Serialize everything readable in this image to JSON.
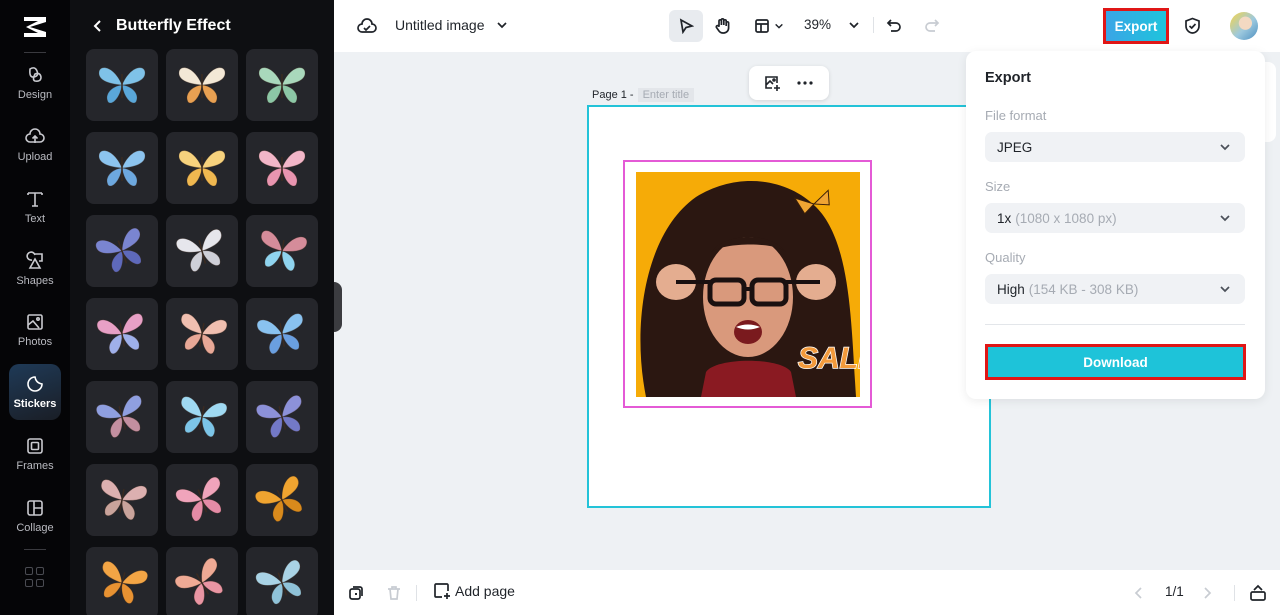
{
  "nav": {
    "logo": "capcut-logo",
    "items": [
      {
        "label": "Design",
        "icon": "design-icon",
        "active": false
      },
      {
        "label": "Upload",
        "icon": "upload-cloud-icon",
        "active": false
      },
      {
        "label": "Text",
        "icon": "text-icon",
        "active": false
      },
      {
        "label": "Shapes",
        "icon": "shapes-icon",
        "active": false
      },
      {
        "label": "Photos",
        "icon": "photo-icon",
        "active": false
      },
      {
        "label": "Stickers",
        "icon": "sticker-icon",
        "active": true
      },
      {
        "label": "Frames",
        "icon": "frame-icon",
        "active": false
      },
      {
        "label": "Collage",
        "icon": "collage-icon",
        "active": false
      }
    ],
    "more": "apps-grid-icon"
  },
  "panel": {
    "title": "Butterfly Effect",
    "back_icon": "chevron-left-icon",
    "stickers": [
      {
        "name": "blue-morpho",
        "c1": "#7fc2e8",
        "c2": "#5aa7d9"
      },
      {
        "name": "cream-spotted",
        "c1": "#f3e8d6",
        "c2": "#e8a052"
      },
      {
        "name": "mint-green",
        "c1": "#a9d8bc",
        "c2": "#8cc7a6"
      },
      {
        "name": "sky-blue",
        "c1": "#8cc4ef",
        "c2": "#6da8df"
      },
      {
        "name": "yellow",
        "c1": "#f7d27d",
        "c2": "#f0b850"
      },
      {
        "name": "pink",
        "c1": "#f2b6c8",
        "c2": "#e995b0"
      },
      {
        "name": "violet-blue",
        "c1": "#7a85d1",
        "c2": "#5e69bb"
      },
      {
        "name": "white",
        "c1": "#e6e6ec",
        "c2": "#cfd0d8"
      },
      {
        "name": "pink-cyan",
        "c1": "#d58c9a",
        "c2": "#8fd4ef"
      },
      {
        "name": "pink-lilac",
        "c1": "#e7a0c6",
        "c2": "#9fb0ea"
      },
      {
        "name": "peach",
        "c1": "#f0bfb0",
        "c2": "#e8a897"
      },
      {
        "name": "blue-black-edge",
        "c1": "#89c2f0",
        "c2": "#6a9fe0"
      },
      {
        "name": "purple-blue",
        "c1": "#8f9fe0",
        "c2": "#c38fa0"
      },
      {
        "name": "light-cyan",
        "c1": "#9fd9f2",
        "c2": "#7cc5e8"
      },
      {
        "name": "periwinkle",
        "c1": "#8c91d9",
        "c2": "#7379c7"
      },
      {
        "name": "dusty-rose",
        "c1": "#dcb0b0",
        "c2": "#c9a39b"
      },
      {
        "name": "bubblegum",
        "c1": "#f0a4bb",
        "c2": "#e58ba6"
      },
      {
        "name": "monarch",
        "c1": "#f0a430",
        "c2": "#d98a1c"
      },
      {
        "name": "orange",
        "c1": "#f3a545",
        "c2": "#e89232"
      },
      {
        "name": "salmon-pink",
        "c1": "#efaa95",
        "c2": "#e995a3"
      },
      {
        "name": "pale-blue",
        "c1": "#a9d3e6",
        "c2": "#8fc2d8"
      }
    ]
  },
  "topbar": {
    "cloud_icon": "cloud-check-icon",
    "doc_title": "Untitled image",
    "zoom": "39%",
    "export_label": "Export",
    "shield_icon": "shield-check-icon"
  },
  "canvas": {
    "page_label": "Page 1 -",
    "title_placeholder": "Enter title",
    "sale_text": "SALE"
  },
  "export_panel": {
    "title": "Export",
    "file_format_label": "File format",
    "file_format_value": "JPEG",
    "size_label": "Size",
    "size_value": "1x",
    "size_detail": "(1080 x 1080 px)",
    "quality_label": "Quality",
    "quality_value": "High",
    "quality_detail": "(154 KB - 308 KB)",
    "download_label": "Download"
  },
  "bottombar": {
    "add_page_label": "Add page",
    "pager": "1/1"
  },
  "colors": {
    "accent": "#1ec3d9",
    "highlight_box": "#e01616",
    "selection": "#e45ad6",
    "page_border": "#23c3d8"
  }
}
